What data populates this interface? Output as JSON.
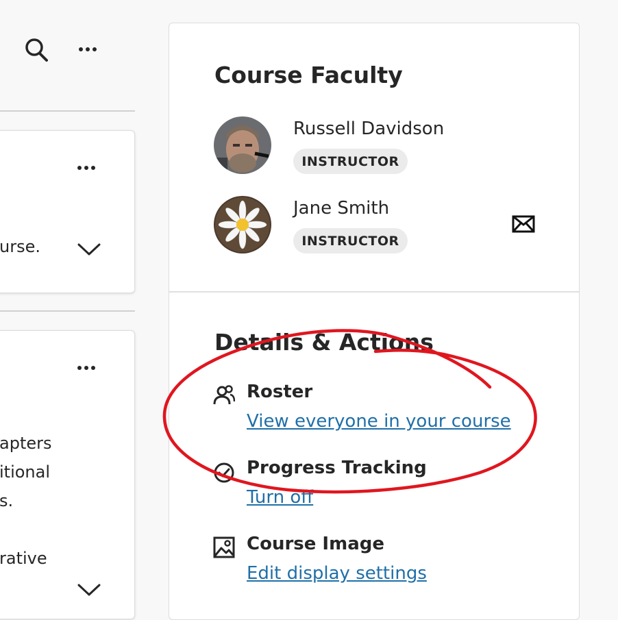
{
  "left": {
    "card1_text": "urse.",
    "card2_lines": [
      "apters",
      "itional",
      "s.",
      "rative"
    ]
  },
  "faculty": {
    "title": "Course Faculty",
    "people": [
      {
        "name": "Russell Davidson",
        "role": "INSTRUCTOR",
        "avatar": "person-photo"
      },
      {
        "name": "Jane Smith",
        "role": "INSTRUCTOR",
        "avatar": "daisy-photo"
      }
    ]
  },
  "details": {
    "title": "Details & Actions",
    "items": [
      {
        "title": "Roster",
        "link": "View everyone in your course",
        "icon": "people-icon"
      },
      {
        "title": "Progress Tracking",
        "link": "Turn off",
        "icon": "check-circle-icon"
      },
      {
        "title": "Course Image",
        "link": "Edit display settings",
        "icon": "image-icon"
      }
    ]
  },
  "colors": {
    "link": "#1f6fa8",
    "annotation": "#e0161f",
    "badge_bg": "#ebebeb"
  }
}
